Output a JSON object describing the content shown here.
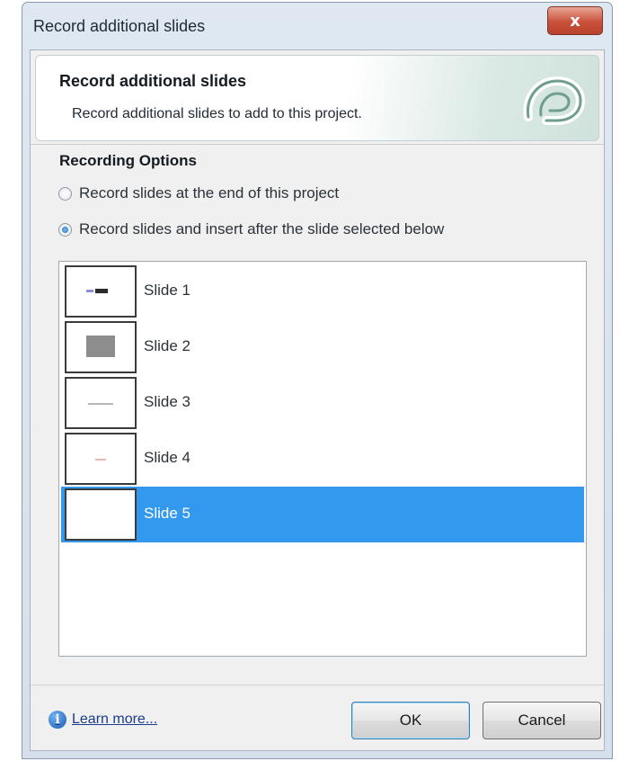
{
  "window": {
    "title": "Record additional slides",
    "close_label": "x"
  },
  "header": {
    "title": "Record additional slides",
    "subtitle": "Record additional slides to add to this project."
  },
  "options": {
    "title": "Recording Options",
    "radios": [
      {
        "label": "Record slides at the end of this project",
        "checked": false
      },
      {
        "label": "Record slides and insert after the slide selected below",
        "checked": true
      }
    ]
  },
  "slides": [
    {
      "label": "Slide 1",
      "selected": false,
      "thumb_icon": "dash-mark"
    },
    {
      "label": "Slide 2",
      "selected": false,
      "thumb_icon": "gray-box"
    },
    {
      "label": "Slide 3",
      "selected": false,
      "thumb_icon": "thin-line"
    },
    {
      "label": "Slide 4",
      "selected": false,
      "thumb_icon": "faint-mark"
    },
    {
      "label": "Slide 5",
      "selected": true,
      "thumb_icon": "blank"
    }
  ],
  "footer": {
    "learn_more": "Learn more...",
    "ok_label": "OK",
    "cancel_label": "Cancel"
  },
  "colors": {
    "selection": "#3399ee",
    "close_button": "#c9513a"
  }
}
